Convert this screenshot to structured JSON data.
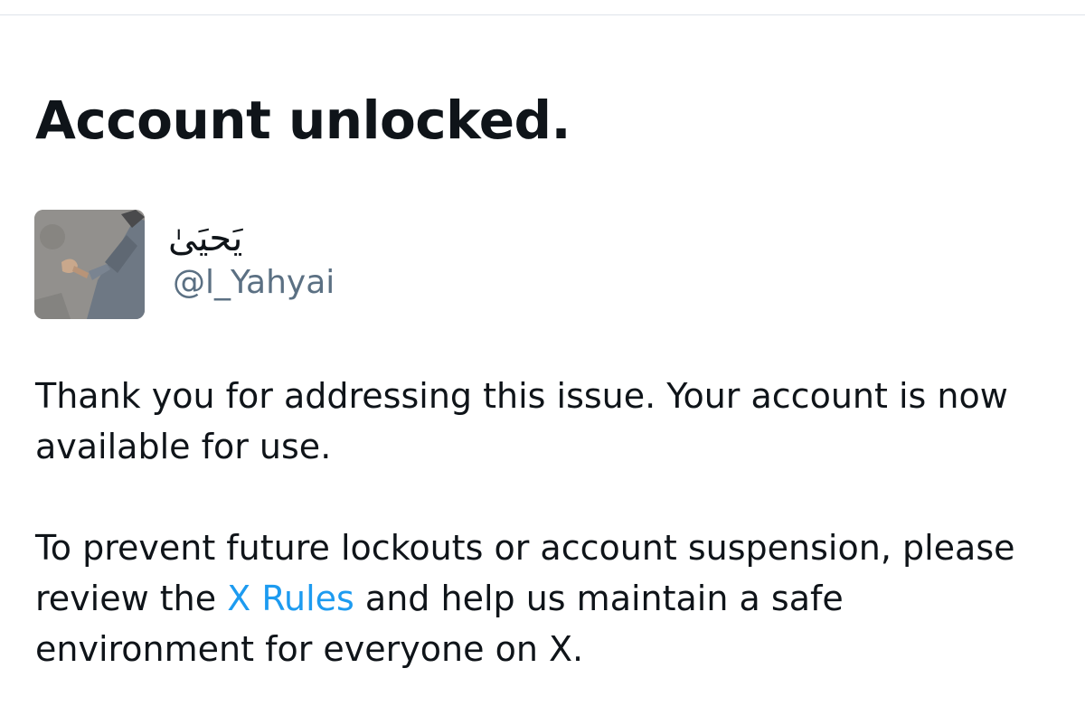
{
  "header": {
    "title": "Account unlocked."
  },
  "account": {
    "display_name": "يَحيَىٰ",
    "handle": "@l_Yahyai",
    "avatar_icon": "user-avatar-photo"
  },
  "message": {
    "paragraph1": "Thank you for addressing this issue. Your account is now available for use.",
    "paragraph2_before": "To prevent future lockouts or account suspension, please review the ",
    "rules_link": "X Rules",
    "paragraph2_after": " and help us maintain a safe environment for everyone on X."
  },
  "colors": {
    "text": "#0f1419",
    "secondary_text": "#5b7083",
    "link": "#1d9bf0",
    "divider": "#dfe3ea"
  }
}
